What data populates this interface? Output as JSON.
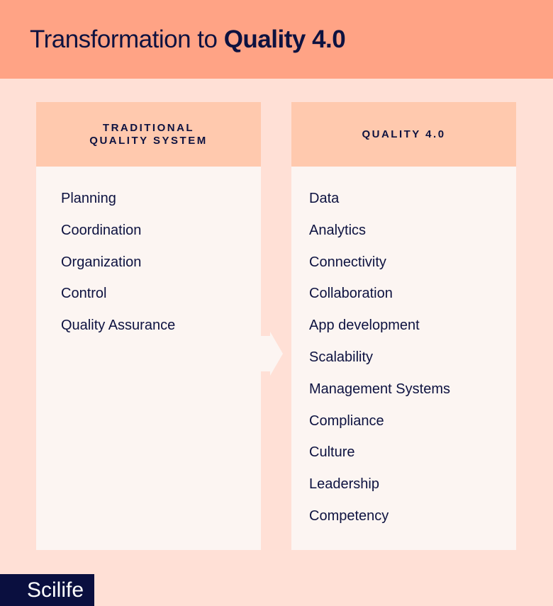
{
  "header": {
    "title_regular": "Transformation to ",
    "title_bold": "Quality 4.0"
  },
  "columns": [
    {
      "heading_lines": [
        "TRADITIONAL",
        "QUALITY SYSTEM"
      ],
      "items": [
        "Planning",
        "Coordination",
        "Organization",
        "Control",
        "Quality Assurance"
      ]
    },
    {
      "heading_lines": [
        "QUALITY 4.0"
      ],
      "items": [
        "Data",
        "Analytics",
        "Connectivity",
        "Collaboration",
        "App development",
        "Scalability",
        "Management Systems",
        "Compliance",
        "Culture",
        "Leadership",
        "Competency"
      ]
    }
  ],
  "connector": {
    "icon": "arrow-right-icon"
  },
  "brand": {
    "logo_text": "Scilife"
  },
  "colors": {
    "header_bg": "#ffa385",
    "page_bg": "#ffe0d6",
    "column_head_bg": "#ffc9ae",
    "column_bg": "#fcf5f2",
    "text": "#0d1240",
    "logo_bg": "#0a0f3f"
  }
}
